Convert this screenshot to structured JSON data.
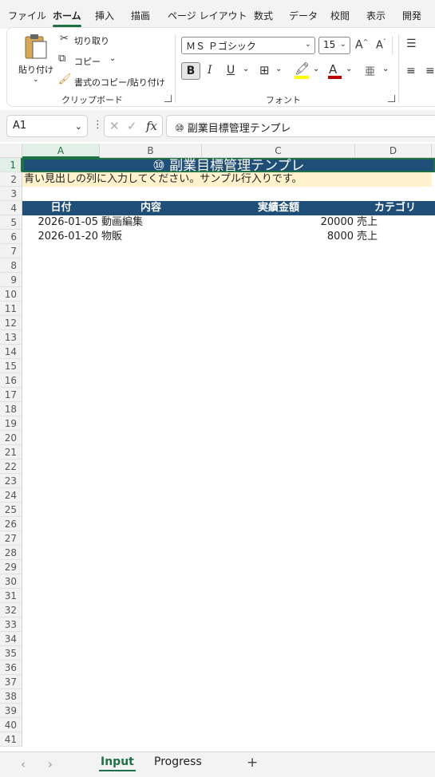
{
  "menu": [
    "ファイル",
    "ホーム",
    "挿入",
    "描画",
    "ページ レイアウト",
    "数式",
    "データ",
    "校閲",
    "表示",
    "開発"
  ],
  "ribbon": {
    "paste_label": "貼り付け",
    "cut_label": "切り取り",
    "copy_label": "コピー",
    "format_painter_label": "書式のコピー/貼り付け",
    "clipboard_group": "クリップボード",
    "font_name": "ＭＳ Ｐゴシック",
    "font_size": "15",
    "font_group": "フォント",
    "bold": "B",
    "italic": "I",
    "underline": "U",
    "grow_font": "A^",
    "shrink_font": "A˅",
    "highlight_color": "#ffff00",
    "font_color": "#c00000"
  },
  "formula_bar": {
    "name_box": "A1",
    "formula": "⑩ 副業目標管理テンプレ"
  },
  "columns": [
    "A",
    "B",
    "C",
    "D"
  ],
  "rows": [
    "1",
    "2",
    "3",
    "4",
    "5",
    "6",
    "7",
    "8",
    "9",
    "10",
    "11",
    "12",
    "13",
    "14",
    "15",
    "16",
    "17",
    "18",
    "19",
    "20",
    "21",
    "22",
    "23",
    "24",
    "25",
    "26",
    "27",
    "28",
    "29",
    "30",
    "31",
    "32",
    "33",
    "34",
    "35",
    "36",
    "37",
    "38",
    "39",
    "40",
    "41"
  ],
  "sheet": {
    "title": "⑩ 副業目標管理テンプレ",
    "note": "青い見出しの列に入力してください。サンプル行入りです。",
    "headers": [
      "日付",
      "内容",
      "実績金額",
      "カテゴリ"
    ],
    "data": [
      [
        "2026-01-05",
        "動画編集",
        "20000",
        "売上"
      ],
      [
        "2026-01-20",
        "物販",
        "8000",
        "売上"
      ]
    ]
  },
  "tabs": {
    "sheets": [
      "Input",
      "Progress"
    ],
    "active": "Input",
    "add": "+"
  },
  "colors": {
    "header_fill": "#1f4e79",
    "note_fill": "#fff2cc",
    "accent": "#1e7145"
  }
}
